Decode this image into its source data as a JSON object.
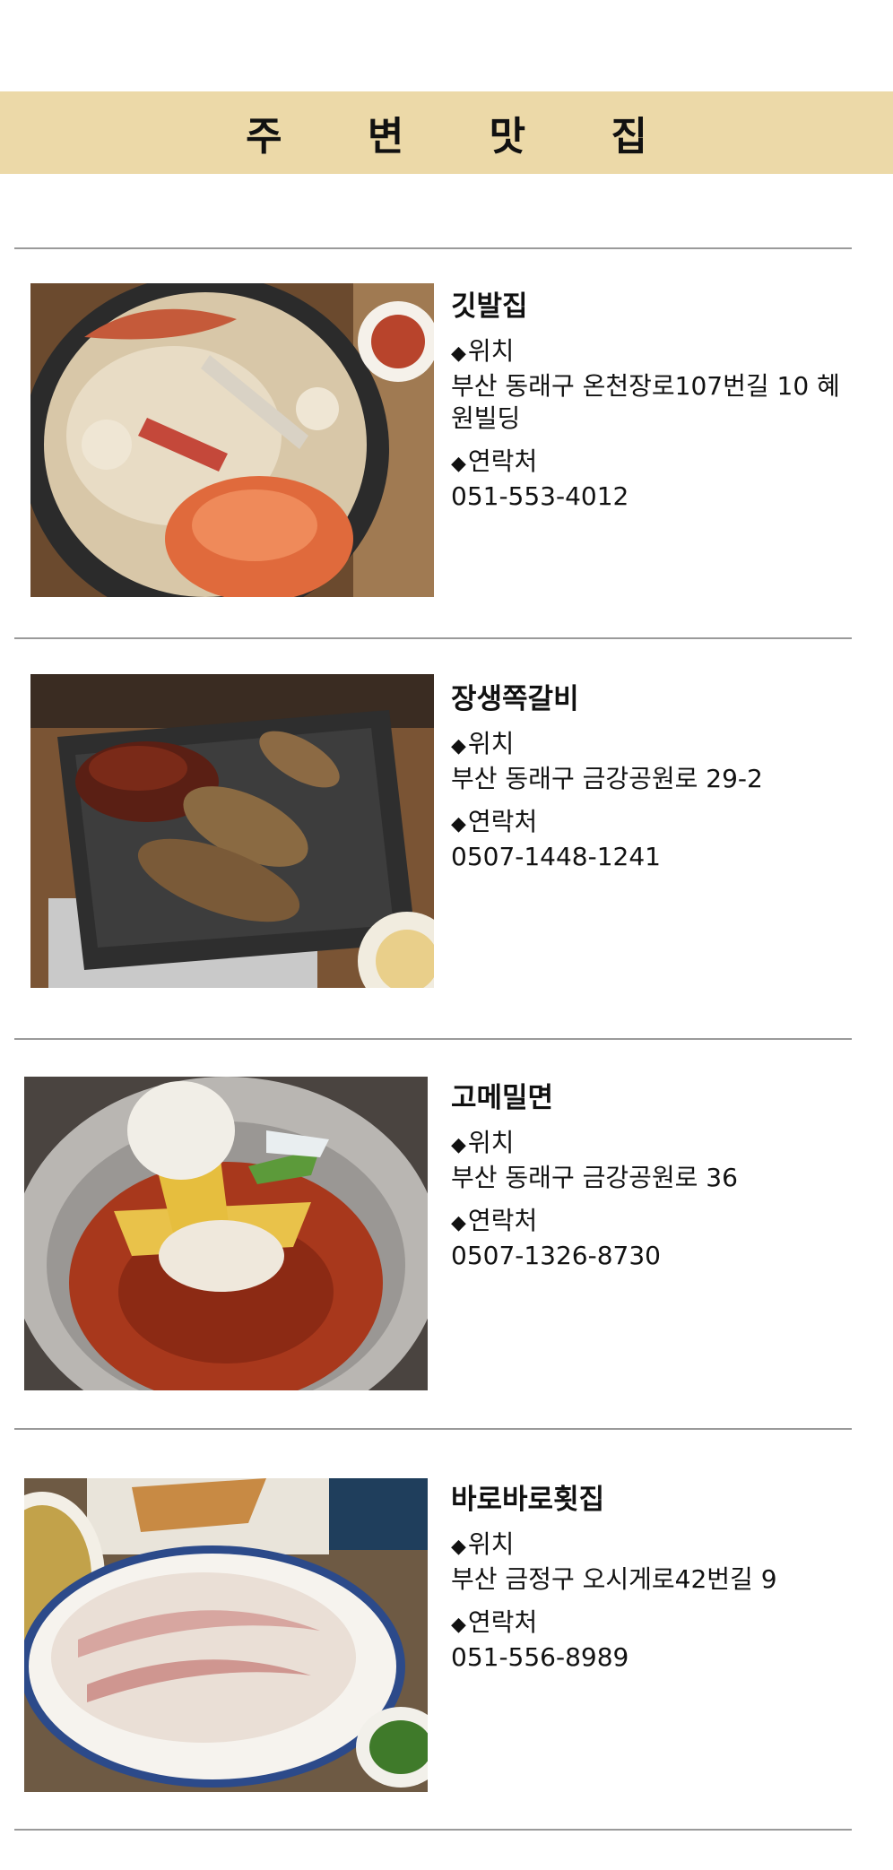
{
  "header": {
    "title": "주 변 맛 집"
  },
  "labels": {
    "location": "위치",
    "contact": "연락처"
  },
  "restaurants": [
    {
      "name": "깃발집",
      "address": "부산 동래구 온천장로107번길 10 혜원빌딩",
      "phone": "051-553-4012",
      "photo": "braised-crab-dish"
    },
    {
      "name": "장생쪽갈비",
      "address": "부산 동래구 금강공원로 29-2",
      "phone": "0507-1448-1241",
      "photo": "grilled-pork-ribs-dish"
    },
    {
      "name": "고메밀면",
      "address": "부산 동래구 금강공원로 36",
      "phone": "0507-1326-8730",
      "photo": "spicy-cold-noodle-dish"
    },
    {
      "name": "바로바로횟집",
      "address": "부산 금정구 오시게로42번길 9",
      "phone": "051-556-8989",
      "photo": "raw-fish-platter-dish"
    }
  ],
  "colors": {
    "banner": "#ecd9a8",
    "divider": "#9a9a9a"
  }
}
